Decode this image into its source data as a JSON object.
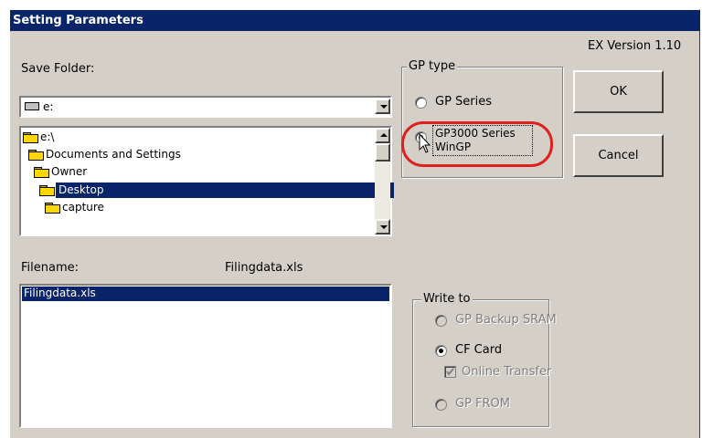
{
  "window": {
    "title": "Setting Parameters",
    "version": "EX Version 1.10"
  },
  "save_folder": {
    "label": "Save Folder:",
    "drive_value": "e:",
    "tree": [
      "e:\\",
      "Documents and Settings",
      "Owner",
      "Desktop",
      "capture"
    ],
    "selected": "Desktop"
  },
  "filename": {
    "label": "Filename:",
    "value": "Filingdata.xls",
    "files": [
      "Filingdata.xls"
    ]
  },
  "gp_type": {
    "legend": "GP type",
    "option1": "GP Series",
    "option2_line1": "GP3000 Series",
    "option2_line2": "WinGP"
  },
  "buttons": {
    "ok": "OK",
    "cancel": "Cancel"
  },
  "write_to": {
    "legend": "Write to",
    "sram": "GP Backup SRAM",
    "cf": "CF Card",
    "online": "Online Transfer",
    "from": "GP FROM"
  },
  "colors": {
    "title_bar": "#0a246a",
    "highlight": "#e02020",
    "face": "#d4d0c8"
  }
}
